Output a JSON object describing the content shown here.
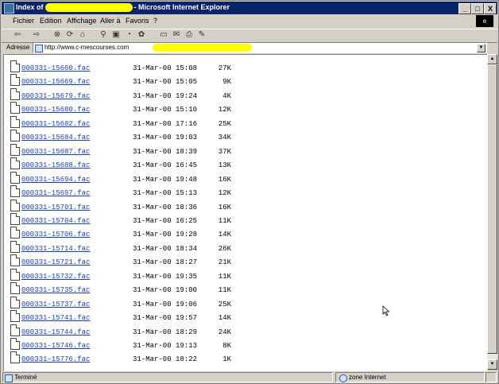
{
  "title": {
    "prefix": "Index of",
    "suffix": "- Microsoft Internet Explorer"
  },
  "window_buttons": [
    "_",
    "□",
    "X"
  ],
  "menu": [
    "Fichier",
    "Edition",
    "Affichage",
    "Aller à",
    "Favoris",
    "?"
  ],
  "toolbar_icons": [
    "back-icon",
    "forward-icon",
    "stop-icon",
    "refresh-icon",
    "home-icon",
    "search-icon",
    "favorites-icon",
    "history-icon",
    "channels-icon",
    "fullscreen-icon",
    "mail-icon",
    "print-icon",
    "edit-icon"
  ],
  "address": {
    "label": "Adresse",
    "url": "http://www.c-mescourses.com"
  },
  "files": [
    {
      "name": "000331-15660.fac",
      "date": "31-Mar-00 15:08",
      "size": "27K"
    },
    {
      "name": "000331-15669.fac",
      "date": "31-Mar-00 15:05",
      "size": "9K"
    },
    {
      "name": "000331-15679.fac",
      "date": "31-Mar-00 19:24",
      "size": "4K"
    },
    {
      "name": "000331-15680.fac",
      "date": "31-Mar-00 15:10",
      "size": "12K"
    },
    {
      "name": "000331-15682.fac",
      "date": "31-Mar-00 17:16",
      "size": "25K"
    },
    {
      "name": "000331-15684.fac",
      "date": "31-Mar-00 19:03",
      "size": "34K"
    },
    {
      "name": "000331-15687.fac",
      "date": "31-Mar-00 18:39",
      "size": "37K"
    },
    {
      "name": "000331-15688.fac",
      "date": "31-Mar-00 16:45",
      "size": "13K"
    },
    {
      "name": "000331-15694.fac",
      "date": "31-Mar-00 19:48",
      "size": "16K"
    },
    {
      "name": "000331-15697.fac",
      "date": "31-Mar-00 15:13",
      "size": "12K"
    },
    {
      "name": "000331-15701.fac",
      "date": "31-Mar-00 18:36",
      "size": "16K"
    },
    {
      "name": "000331-15704.fac",
      "date": "31-Mar-00 16:25",
      "size": "11K"
    },
    {
      "name": "000331-15706.fac",
      "date": "31-Mar-00 19:28",
      "size": "14K"
    },
    {
      "name": "000331-15714.fac",
      "date": "31-Mar-00 18:34",
      "size": "26K"
    },
    {
      "name": "000331-15721.fac",
      "date": "31-Mar-00 18:27",
      "size": "21K"
    },
    {
      "name": "000331-15732.fac",
      "date": "31-Mar-00 19:35",
      "size": "11K"
    },
    {
      "name": "000331-15735.fac",
      "date": "31-Mar-00 19:00",
      "size": "11K"
    },
    {
      "name": "000331-15737.fac",
      "date": "31-Mar-00 19:06",
      "size": "25K"
    },
    {
      "name": "000331-15741.fac",
      "date": "31-Mar-00 19:57",
      "size": "14K"
    },
    {
      "name": "000331-15744.fac",
      "date": "31-Mar-00 18:29",
      "size": "24K"
    },
    {
      "name": "000331-15746.fac",
      "date": "31-Mar-00 19:13",
      "size": "8K"
    },
    {
      "name": "000331-15776.fac",
      "date": "31-Mar-00 18:22",
      "size": "1K"
    }
  ],
  "status": {
    "left": "Terminé",
    "zone": "zone Internet"
  },
  "colors": {
    "titlebar": "#0a246a",
    "link": "#1a3dbd",
    "highlight": "#ffff00"
  }
}
